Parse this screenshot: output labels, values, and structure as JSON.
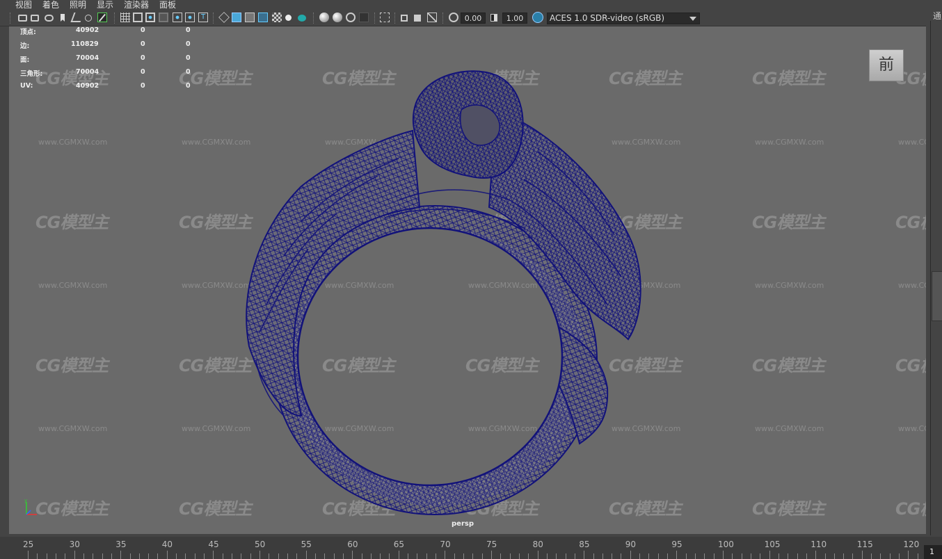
{
  "menu": [
    "视图",
    "着色",
    "照明",
    "显示",
    "渲染器",
    "面板"
  ],
  "toolbar": {
    "exposure_value": "0.00",
    "gamma_value": "1.00",
    "color_space": "ACES 1.0 SDR-video (sRGB)",
    "icons": [
      "camera-icon",
      "camera-attrs-icon",
      "bookmark-icon",
      "image-plane-icon",
      "grease-pencil-icon",
      "grid-icon",
      "film-gate-icon",
      "resolution-gate-icon",
      "gate-mask-icon",
      "field-chart-icon",
      "safe-action-icon",
      "wireframe-icon",
      "smooth-shade-icon",
      "wireframe-on-shaded-icon",
      "textured-icon",
      "lights-icon",
      "shadows-icon",
      "ambient-occlusion-icon",
      "motion-blur-icon",
      "anti-aliasing-icon",
      "isolate-select-icon",
      "xray-icon",
      "xray-joints-icon",
      "backface-icon",
      "exposure-icon",
      "gamma-icon",
      "color-management-icon"
    ]
  },
  "hud": {
    "rows": [
      {
        "label": "顶点:",
        "a": "40902",
        "b": "0",
        "c": "0"
      },
      {
        "label": "边:",
        "a": "110829",
        "b": "0",
        "c": "0"
      },
      {
        "label": "面:",
        "a": "70004",
        "b": "0",
        "c": "0"
      },
      {
        "label": "三角形:",
        "a": "70004",
        "b": "0",
        "c": "0"
      },
      {
        "label": "UV:",
        "a": "40902",
        "b": "0",
        "c": "0"
      }
    ]
  },
  "view_cube_label": "前",
  "camera_label": "persp",
  "right_panel_glyph": "通",
  "watermark": {
    "logo": "CG模型主",
    "url": "www.CGMXW.com"
  },
  "timeline": {
    "ticks": [
      "25",
      "30",
      "35",
      "40",
      "45",
      "50",
      "55",
      "60",
      "65",
      "70",
      "75",
      "80",
      "85",
      "90",
      "95",
      "100",
      "105",
      "110",
      "115",
      "120"
    ],
    "current_frame": "1"
  },
  "colors": {
    "wire": "#12127a",
    "viewport_bg": "#6a6a6a",
    "ui_bg": "#444444"
  }
}
